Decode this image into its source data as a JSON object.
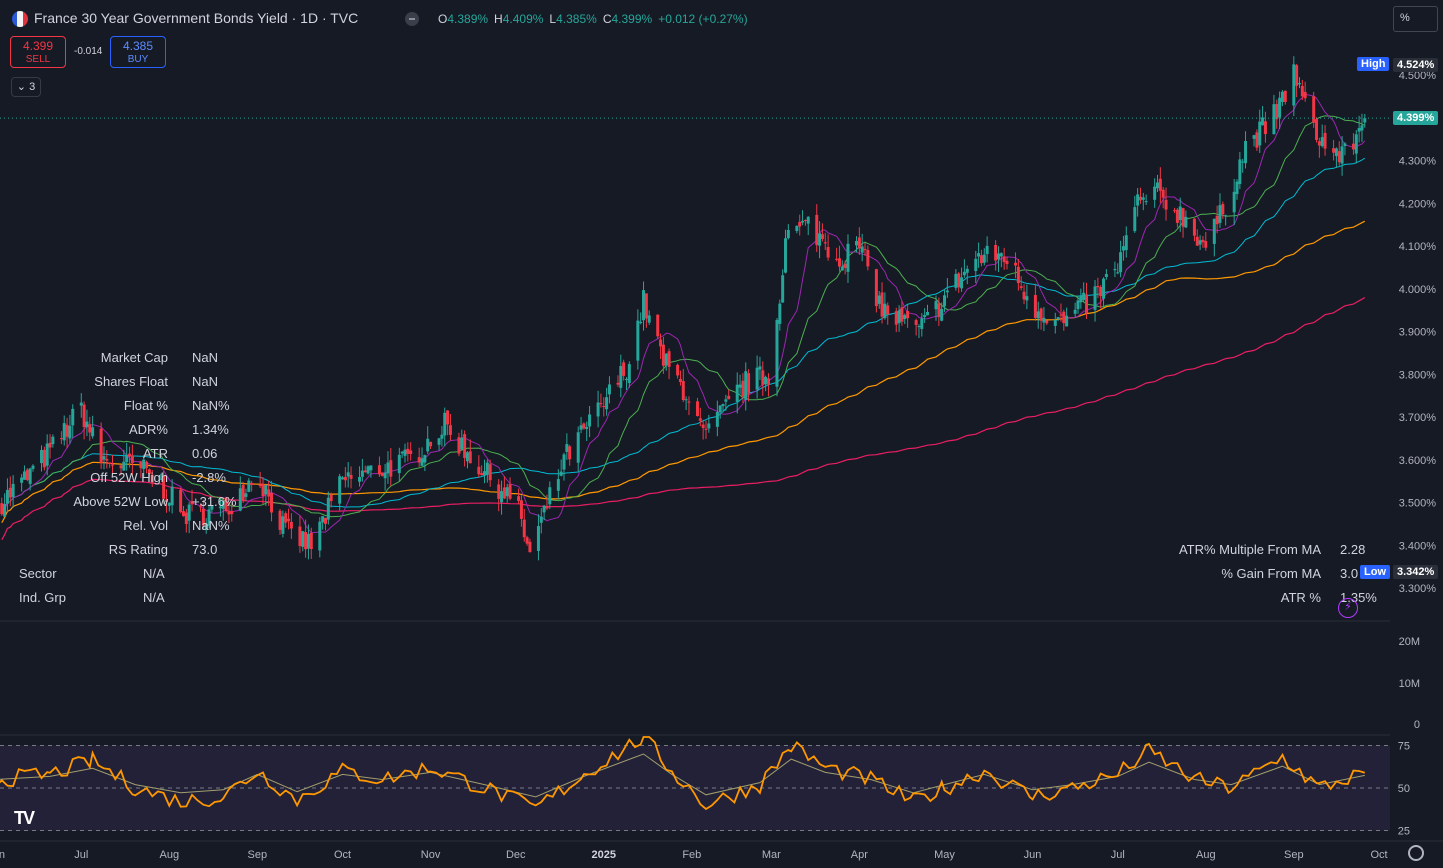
{
  "header": {
    "title": "France 30 Year Government Bonds Yield · 1D · TVC",
    "ohlc": [
      {
        "k": "O",
        "v": "4.389%"
      },
      {
        "k": "H",
        "v": "4.409%"
      },
      {
        "k": "L",
        "v": "4.385%"
      },
      {
        "k": "C",
        "v": "4.399%"
      },
      {
        "k": "",
        "v": "+0.012 (+0.27%)"
      }
    ],
    "sell_price": "4.399",
    "sell_label": "SELL",
    "buy_price": "4.385",
    "buy_label": "BUY",
    "spread": "-0.014",
    "indicators_collapsed": "⌄ 3",
    "scale_mode": "%"
  },
  "colors": {
    "background": "#161a25",
    "up": "#26a69a",
    "down": "#f23645",
    "ma_purple": "#9c27b0",
    "ma_green": "#4caf50",
    "ma_teal": "#00bcd4",
    "ma_orange": "#ff9800",
    "ma_pink": "#e91e63",
    "rsi": "#ff9800"
  },
  "price_tags": {
    "high_label": "High",
    "high_value": "4.524%",
    "current_value": "4.399%",
    "low_label": "Low",
    "low_value": "3.342%"
  },
  "price_axis_labels": [
    "4.500%",
    "4.400%",
    "4.300%",
    "4.200%",
    "4.100%",
    "4.000%",
    "3.900%",
    "3.800%",
    "3.700%",
    "3.600%",
    "3.500%",
    "3.400%",
    "3.300%"
  ],
  "volume_axis_labels": [
    "20M",
    "10M",
    "0"
  ],
  "rsi_axis_labels": [
    "75",
    "50",
    "25"
  ],
  "time_axis_labels": [
    {
      "t": "Jun",
      "b": false
    },
    {
      "t": "Jul",
      "b": false
    },
    {
      "t": "Aug",
      "b": false
    },
    {
      "t": "Sep",
      "b": false
    },
    {
      "t": "Oct",
      "b": false
    },
    {
      "t": "Nov",
      "b": false
    },
    {
      "t": "Dec",
      "b": false
    },
    {
      "t": "2025",
      "b": true
    },
    {
      "t": "Feb",
      "b": false
    },
    {
      "t": "Mar",
      "b": false
    },
    {
      "t": "Apr",
      "b": false
    },
    {
      "t": "May",
      "b": false
    },
    {
      "t": "Jun",
      "b": false
    },
    {
      "t": "Jul",
      "b": false
    },
    {
      "t": "Aug",
      "b": false
    },
    {
      "t": "Sep",
      "b": false
    },
    {
      "t": "Oct",
      "b": false
    }
  ],
  "stats_left": [
    {
      "k": "Market Cap",
      "v": "NaN"
    },
    {
      "k": "Shares Float",
      "v": "NaN"
    },
    {
      "k": "Float %",
      "v": "NaN%"
    },
    {
      "k": "ADR%",
      "v": "1.34%"
    },
    {
      "k": "ATR",
      "v": "0.06"
    },
    {
      "k": "Off 52W High",
      "v": "-2.8%"
    },
    {
      "k": "Above 52W Low",
      "v": "+31.6%"
    },
    {
      "k": "Rel. Vol",
      "v": "NaN%"
    },
    {
      "k": "RS Rating",
      "v": "73.0"
    }
  ],
  "stats_sector": [
    {
      "k": "Sector",
      "v": "N/A"
    },
    {
      "k": "Ind. Grp",
      "v": "N/A"
    }
  ],
  "stats_right": [
    {
      "k": "ATR% Multiple From MA",
      "v": "2.28"
    },
    {
      "k": "% Gain From MA",
      "v": "3.0"
    },
    {
      "k": "ATR %",
      "v": "1.35%"
    }
  ],
  "chart_data": [
    {
      "type": "candlestick",
      "title": "France 30 Year Government Bonds Yield",
      "ylim": [
        3.28,
        4.53
      ],
      "series_close": [
        {
          "x": "2024-06-01",
          "y": 3.49
        },
        {
          "x": "2024-06-12",
          "y": 3.56
        },
        {
          "x": "2024-06-20",
          "y": 3.62
        },
        {
          "x": "2024-07-01",
          "y": 3.72
        },
        {
          "x": "2024-07-08",
          "y": 3.6
        },
        {
          "x": "2024-07-22",
          "y": 3.58
        },
        {
          "x": "2024-08-01",
          "y": 3.52
        },
        {
          "x": "2024-08-05",
          "y": 3.47
        },
        {
          "x": "2024-08-20",
          "y": 3.48
        },
        {
          "x": "2024-09-01",
          "y": 3.57
        },
        {
          "x": "2024-09-11",
          "y": 3.43
        },
        {
          "x": "2024-09-20",
          "y": 3.4
        },
        {
          "x": "2024-10-01",
          "y": 3.55
        },
        {
          "x": "2024-10-15",
          "y": 3.58
        },
        {
          "x": "2024-10-25",
          "y": 3.6
        },
        {
          "x": "2024-11-01",
          "y": 3.65
        },
        {
          "x": "2024-11-06",
          "y": 3.68
        },
        {
          "x": "2024-11-20",
          "y": 3.57
        },
        {
          "x": "2024-12-01",
          "y": 3.5
        },
        {
          "x": "2024-12-06",
          "y": 3.38
        },
        {
          "x": "2024-12-18",
          "y": 3.6
        },
        {
          "x": "2025-01-01",
          "y": 3.73
        },
        {
          "x": "2025-01-10",
          "y": 3.83
        },
        {
          "x": "2025-01-15",
          "y": 3.97
        },
        {
          "x": "2025-01-22",
          "y": 3.83
        },
        {
          "x": "2025-02-01",
          "y": 3.74
        },
        {
          "x": "2025-02-05",
          "y": 3.65
        },
        {
          "x": "2025-02-20",
          "y": 3.78
        },
        {
          "x": "2025-03-01",
          "y": 3.8
        },
        {
          "x": "2025-03-06",
          "y": 4.12
        },
        {
          "x": "2025-03-14",
          "y": 4.15
        },
        {
          "x": "2025-03-25",
          "y": 4.07
        },
        {
          "x": "2025-04-01",
          "y": 4.1
        },
        {
          "x": "2025-04-09",
          "y": 3.95
        },
        {
          "x": "2025-04-22",
          "y": 3.9
        },
        {
          "x": "2025-05-01",
          "y": 3.98
        },
        {
          "x": "2025-05-12",
          "y": 4.07
        },
        {
          "x": "2025-05-22",
          "y": 4.08
        },
        {
          "x": "2025-06-01",
          "y": 3.96
        },
        {
          "x": "2025-06-12",
          "y": 3.92
        },
        {
          "x": "2025-06-24",
          "y": 3.99
        },
        {
          "x": "2025-07-01",
          "y": 4.05
        },
        {
          "x": "2025-07-08",
          "y": 4.2
        },
        {
          "x": "2025-07-15",
          "y": 4.22
        },
        {
          "x": "2025-07-24",
          "y": 4.17
        },
        {
          "x": "2025-08-01",
          "y": 4.1
        },
        {
          "x": "2025-08-07",
          "y": 4.18
        },
        {
          "x": "2025-08-15",
          "y": 4.33
        },
        {
          "x": "2025-08-26",
          "y": 4.41
        },
        {
          "x": "2025-09-01",
          "y": 4.51
        },
        {
          "x": "2025-09-05",
          "y": 4.42
        },
        {
          "x": "2025-09-12",
          "y": 4.33
        },
        {
          "x": "2025-09-19",
          "y": 4.31
        },
        {
          "x": "2025-09-26",
          "y": 4.399
        }
      ]
    },
    {
      "type": "bar",
      "title": "Volume",
      "ylim": [
        0,
        25000000
      ],
      "values": []
    },
    {
      "type": "line",
      "title": "RSI",
      "ylim": [
        20,
        80
      ],
      "guides": [
        75,
        50,
        25
      ],
      "points": [
        {
          "x": "2024-06-01",
          "y": 55
        },
        {
          "x": "2024-06-20",
          "y": 58
        },
        {
          "x": "2024-07-05",
          "y": 66
        },
        {
          "x": "2024-07-20",
          "y": 50
        },
        {
          "x": "2024-08-05",
          "y": 42
        },
        {
          "x": "2024-08-20",
          "y": 45
        },
        {
          "x": "2024-09-01",
          "y": 60
        },
        {
          "x": "2024-09-15",
          "y": 43
        },
        {
          "x": "2024-10-01",
          "y": 60
        },
        {
          "x": "2024-10-15",
          "y": 55
        },
        {
          "x": "2024-11-01",
          "y": 62
        },
        {
          "x": "2024-11-20",
          "y": 50
        },
        {
          "x": "2024-12-08",
          "y": 38
        },
        {
          "x": "2024-12-25",
          "y": 58
        },
        {
          "x": "2025-01-15",
          "y": 80
        },
        {
          "x": "2025-01-25",
          "y": 60
        },
        {
          "x": "2025-02-06",
          "y": 40
        },
        {
          "x": "2025-02-25",
          "y": 52
        },
        {
          "x": "2025-03-08",
          "y": 75
        },
        {
          "x": "2025-03-20",
          "y": 62
        },
        {
          "x": "2025-04-05",
          "y": 55
        },
        {
          "x": "2025-04-20",
          "y": 42
        },
        {
          "x": "2025-05-01",
          "y": 50
        },
        {
          "x": "2025-05-15",
          "y": 60
        },
        {
          "x": "2025-06-01",
          "y": 45
        },
        {
          "x": "2025-06-15",
          "y": 50
        },
        {
          "x": "2025-07-01",
          "y": 58
        },
        {
          "x": "2025-07-12",
          "y": 72
        },
        {
          "x": "2025-07-28",
          "y": 55
        },
        {
          "x": "2025-08-10",
          "y": 50
        },
        {
          "x": "2025-08-28",
          "y": 68
        },
        {
          "x": "2025-09-10",
          "y": 50
        },
        {
          "x": "2025-09-26",
          "y": 59
        }
      ]
    }
  ]
}
